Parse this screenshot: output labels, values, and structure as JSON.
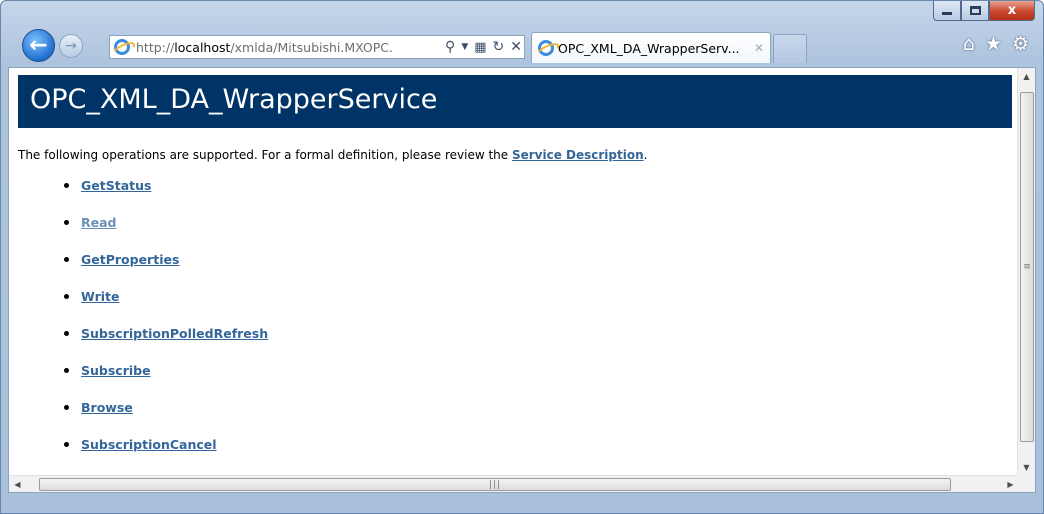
{
  "browser": {
    "address": {
      "prefix": "http://",
      "host": "localhost",
      "path": "/xmlda/Mitsubishi.MXOPC."
    },
    "tab": {
      "title": "OPC_XML_DA_WrapperServ..."
    },
    "icons": [
      "back-arrow-icon",
      "forward-arrow-icon",
      "search-icon",
      "compat-view-icon",
      "refresh-icon",
      "stop-icon",
      "home-icon",
      "favorites-star-icon",
      "tools-gear-icon"
    ],
    "caption": {
      "close_glyph": "x"
    }
  },
  "page": {
    "heading": "OPC_XML_DA_WrapperService",
    "intro_text": "The following operations are supported. For a formal definition, please review the ",
    "intro_link": "Service Description",
    "intro_suffix": ".",
    "operations": [
      {
        "label": "GetStatus",
        "visited": false
      },
      {
        "label": "Read",
        "visited": true
      },
      {
        "label": "GetProperties",
        "visited": false
      },
      {
        "label": "Write",
        "visited": false
      },
      {
        "label": "SubscriptionPolledRefresh",
        "visited": false
      },
      {
        "label": "Subscribe",
        "visited": false
      },
      {
        "label": "Browse",
        "visited": false
      },
      {
        "label": "SubscriptionCancel",
        "visited": false
      }
    ]
  },
  "colors": {
    "header_bg": "#003366",
    "link": "#336699",
    "visited_link": "#6b8fb8"
  }
}
